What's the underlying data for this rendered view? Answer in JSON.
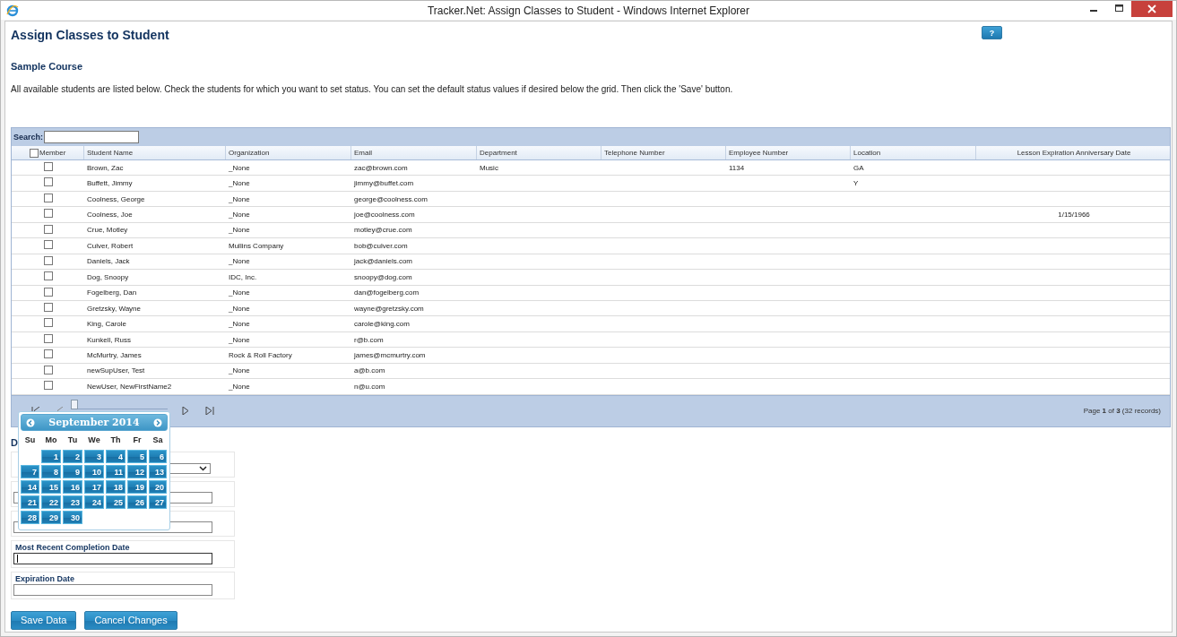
{
  "window": {
    "title": "Tracker.Net: Assign Classes to Student - Windows Internet Explorer"
  },
  "page": {
    "title": "Assign Classes to Student",
    "help_button": "?",
    "course": "Sample Course",
    "instructions": "All available students are listed below. Check the students for which you want to set status. You can set the default status values if desired below the grid. Then click the 'Save' button."
  },
  "grid": {
    "search_label": "Search:",
    "select_all_checked": false,
    "columns": [
      "Member",
      "Student Name",
      "Organization",
      "Email",
      "Department",
      "Telephone Number",
      "Employee Number",
      "Location",
      "Lesson Expiration Anniversary Date"
    ],
    "rows": [
      {
        "checked": false,
        "name": "Brown, Zac",
        "organization": "_None",
        "email": "zac@brown.com",
        "department": "Music",
        "employee_number": "1134",
        "location": "GA"
      },
      {
        "checked": false,
        "name": "Buffett, Jimmy",
        "organization": "_None",
        "email": "jimmy@buffet.com",
        "location": "Y"
      },
      {
        "checked": false,
        "name": "Coolness, George",
        "organization": "_None",
        "email": "george@coolness.com"
      },
      {
        "checked": false,
        "name": "Coolness, Joe",
        "organization": "_None",
        "email": "joe@coolness.com",
        "lesson_expiration_anniversary_date": "1/15/1966"
      },
      {
        "checked": false,
        "name": "Crue, Motley",
        "organization": "_None",
        "email": "motley@crue.com"
      },
      {
        "checked": false,
        "name": "Culver, Robert",
        "organization": "Mullins Company",
        "email": "bob@culver.com"
      },
      {
        "checked": false,
        "name": "Daniels, Jack",
        "organization": "_None",
        "email": "jack@daniels.com"
      },
      {
        "checked": false,
        "name": "Dog, Snoopy",
        "organization": "IDC, Inc.",
        "email": "snoopy@dog.com"
      },
      {
        "checked": false,
        "name": "Fogelberg, Dan",
        "organization": "_None",
        "email": "dan@fogelberg.com"
      },
      {
        "checked": false,
        "name": "Gretzsky, Wayne",
        "organization": "_None",
        "email": "wayne@gretzsky.com"
      },
      {
        "checked": false,
        "name": "King, Carole",
        "organization": "_None",
        "email": "carole@king.com"
      },
      {
        "checked": false,
        "name": "Kunkell, Russ",
        "organization": "_None",
        "email": "r@b.com"
      },
      {
        "checked": false,
        "name": "McMurtry, James",
        "organization": "Rock & Roll Factory",
        "email": "james@mcmurtry.com"
      },
      {
        "checked": false,
        "name": "newSupUser, Test",
        "organization": "_None",
        "email": "a@b.com"
      },
      {
        "checked": false,
        "name": "NewUser, NewFirstName2",
        "organization": "_None",
        "email": "n@u.com"
      }
    ],
    "pager": {
      "slider": {
        "level": 0
      },
      "summary": "Page **1** of **3** (32 records)"
    }
  },
  "form": {
    "heading": "D",
    "fields": [
      {
        "kind": "select"
      },
      {
        "kind": "input"
      },
      {
        "kind": "input"
      },
      {
        "kind": "input",
        "label": "Most Recent Completion Date",
        "focused": true
      },
      {
        "kind": "input",
        "label": "Expiration Date",
        "focused": false
      }
    ]
  },
  "calendar": {
    "title": "September 2014",
    "day_names": [
      "Su",
      "Mo",
      "Tu",
      "We",
      "Th",
      "Fr",
      "Sa"
    ],
    "weeks": [
      [
        "1",
        "2",
        "3",
        "4",
        "5",
        "6"
      ],
      [
        "7",
        "8",
        "9",
        "10",
        "11",
        "12",
        "13"
      ],
      [
        "14",
        "15",
        "16",
        "17",
        "18",
        "19",
        "20"
      ],
      [
        "21",
        "22",
        "23",
        "24",
        "25",
        "26",
        "27"
      ],
      [
        "28",
        "29",
        "30"
      ]
    ]
  },
  "buttons": [
    "Save Data",
    "Cancel Changes"
  ]
}
